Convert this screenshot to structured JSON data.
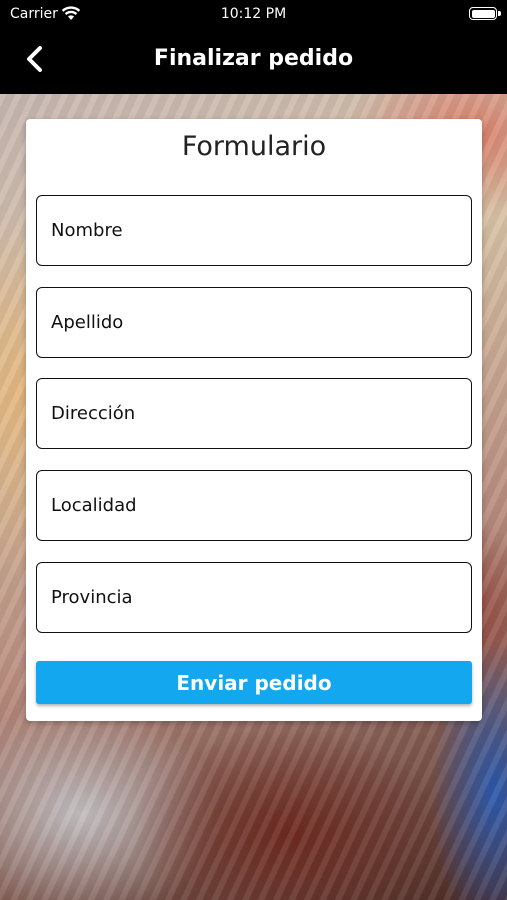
{
  "status_bar": {
    "carrier": "Carrier",
    "time": "10:12 PM",
    "wifi_icon": "wifi-icon",
    "battery_icon": "battery-icon"
  },
  "nav": {
    "title": "Finalizar pedido",
    "back_icon": "chevron-left-icon"
  },
  "form": {
    "title": "Formulario",
    "fields": [
      {
        "placeholder": "Nombre",
        "value": ""
      },
      {
        "placeholder": "Apellido",
        "value": ""
      },
      {
        "placeholder": "Dirección",
        "value": ""
      },
      {
        "placeholder": "Localidad",
        "value": ""
      },
      {
        "placeholder": "Provincia",
        "value": ""
      }
    ],
    "submit_label": "Enviar pedido"
  },
  "colors": {
    "accent": "#12a7ef",
    "nav_background": "#000000",
    "card_background": "#ffffff"
  }
}
